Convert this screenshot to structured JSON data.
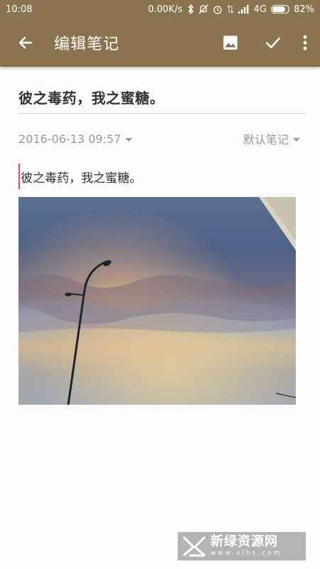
{
  "status_bar": {
    "time": "10:08",
    "speed": "0.00K/s",
    "network": "4G",
    "battery": "82%",
    "battery_level": 0.82
  },
  "toolbar": {
    "title": "编辑笔记",
    "color": "#8a7450"
  },
  "note": {
    "title": "彼之毒药，我之蜜糖。",
    "date": "2016-06-13 09:57",
    "notebook": "默认笔记",
    "body": "彼之毒药，我之蜜糖。",
    "cursor_color": "#e0457b"
  },
  "watermark": {
    "main": "新绿资源网",
    "sub": "www.xlhs.com"
  }
}
